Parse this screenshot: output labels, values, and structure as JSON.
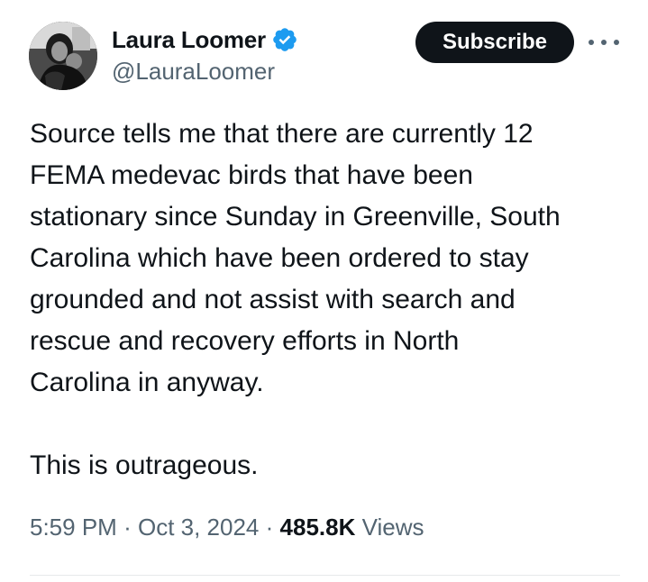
{
  "author": {
    "display_name": "Laura Loomer",
    "handle": "@LauraLoomer",
    "verified": true,
    "verified_color": "#1d9bf0"
  },
  "actions": {
    "subscribe_label": "Subscribe",
    "more_icon": "more-horizontal-icon"
  },
  "tweet": {
    "text": "Source tells me that there are currently 12\nFEMA medevac birds that have been\nstationary since Sunday in Greenville, South\nCarolina which have been ordered to stay\ngrounded and not assist with search and\nrescue and recovery efforts in North\nCarolina in anyway.\n\nThis is outrageous.",
    "time": "5:59 PM",
    "separator": "·",
    "date": "Oct 3, 2024",
    "views_count": "485.8K",
    "views_label": "Views"
  },
  "colors": {
    "text_primary": "#0f1419",
    "text_secondary": "#536471",
    "button_bg": "#0f1419",
    "divider": "#e6e9ea"
  }
}
